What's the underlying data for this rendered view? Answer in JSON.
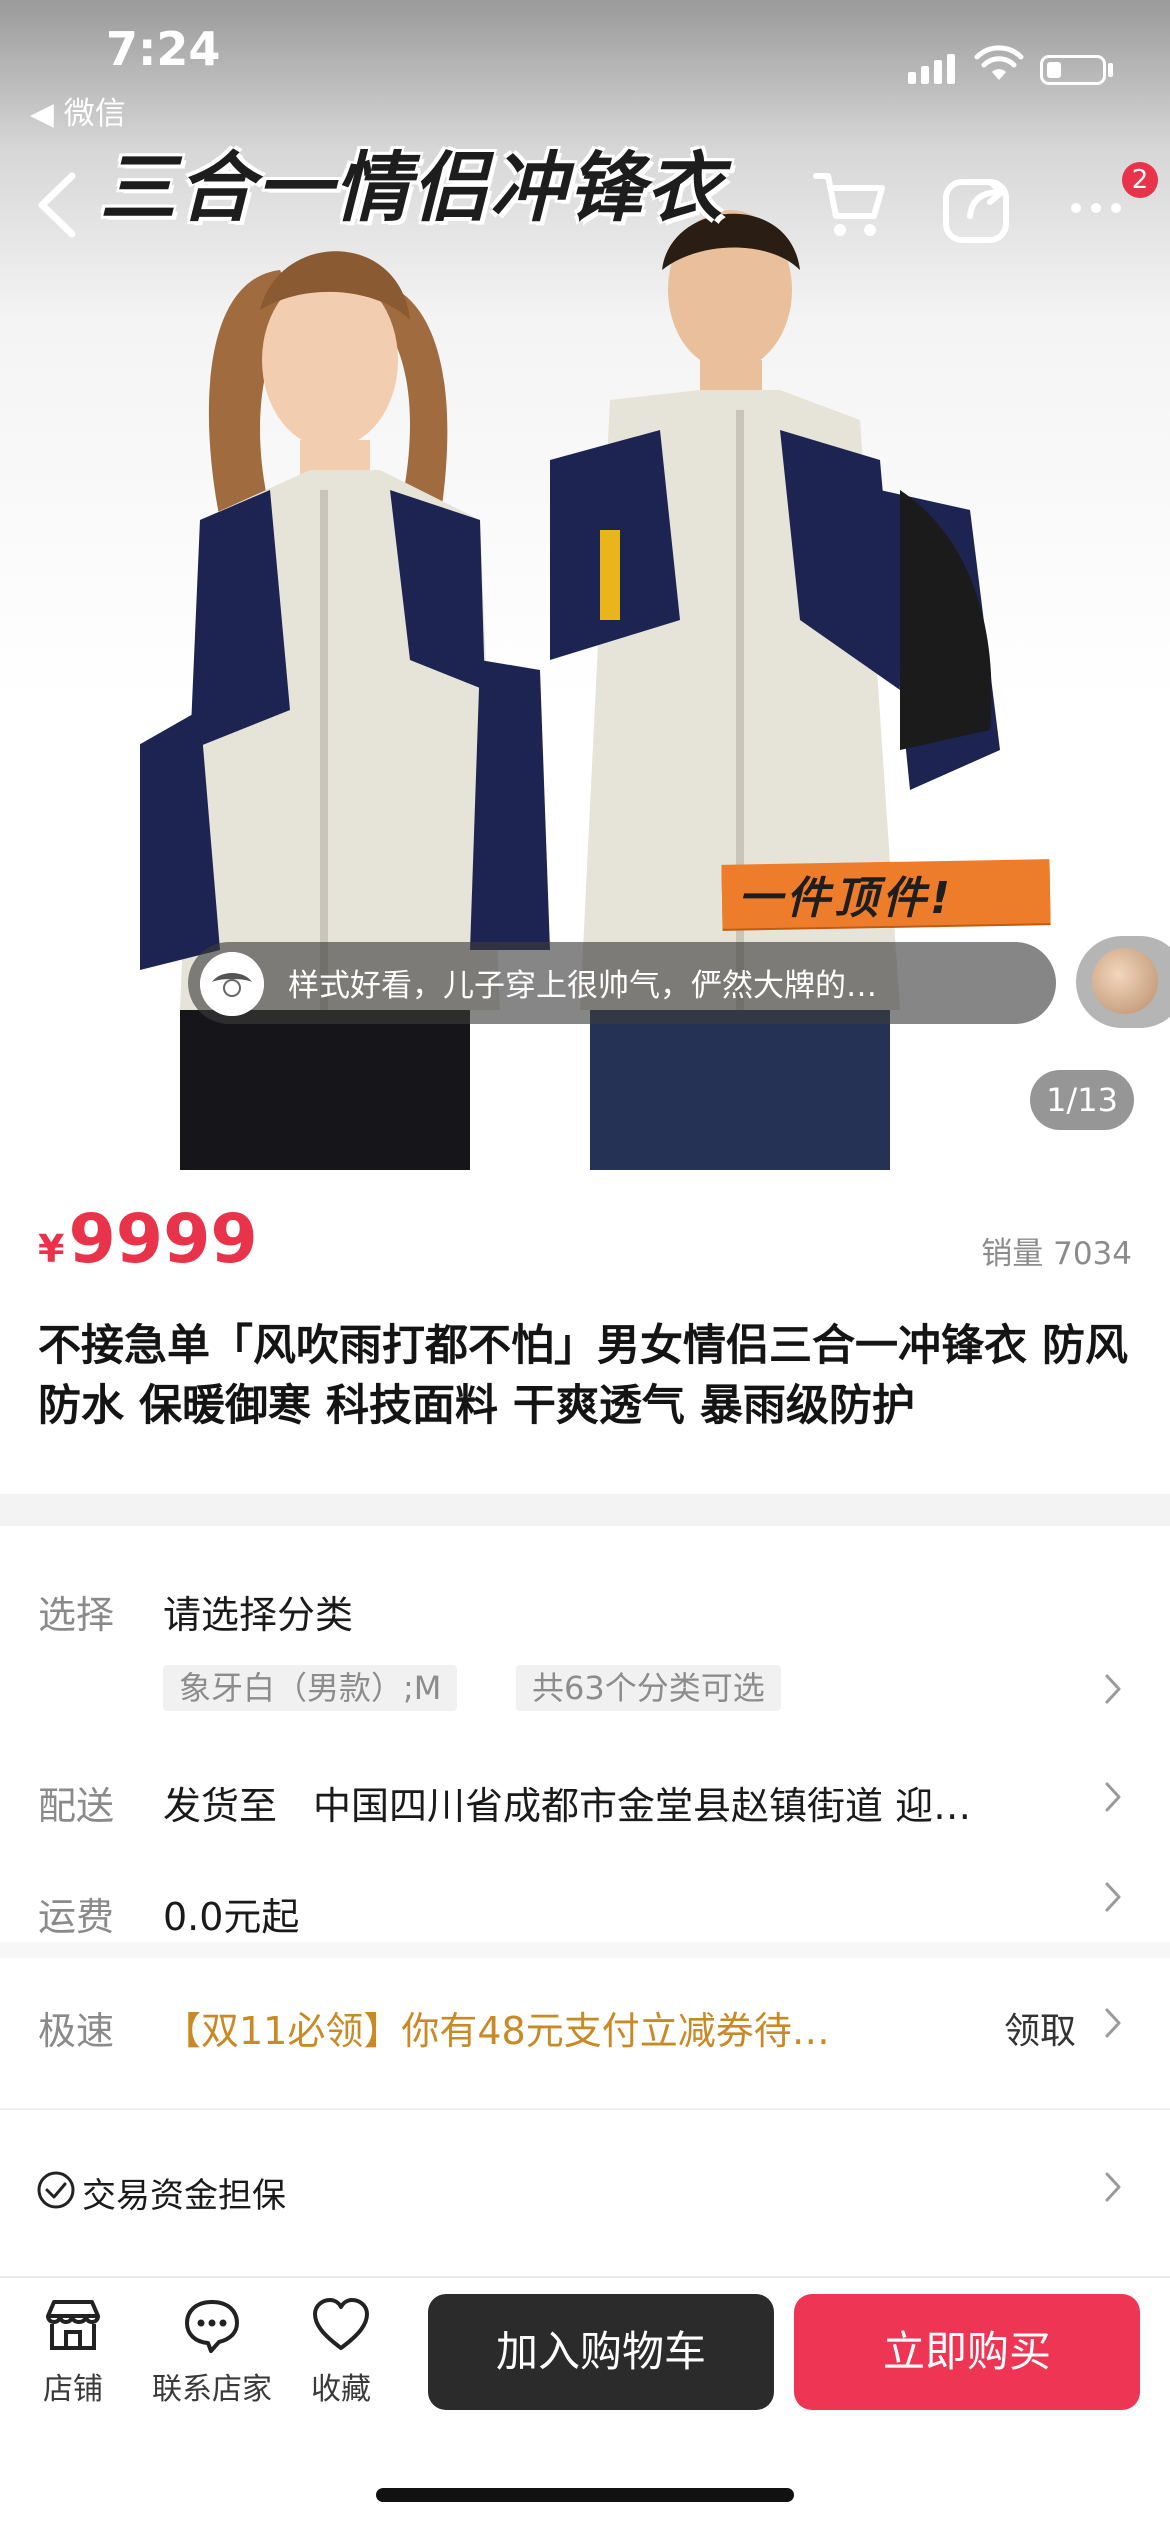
{
  "status_bar": {
    "time": "7:24",
    "back_app_label": "◀ 微信"
  },
  "nav": {
    "headline": "三合一情侣冲锋衣",
    "cart_badge": "2"
  },
  "hero": {
    "stamp_text": "一件顶件!",
    "review_text": "样式好看，儿子穿上很帅气，俨然大牌的…",
    "image_counter": "1/13"
  },
  "product": {
    "currency": "¥",
    "price": "9999",
    "sales": "销量 7034",
    "title": "不接急单「风吹雨打都不怕」男女情侣三合一冲锋衣 防风防水 保暖御寒 科技面料 干爽透气 暴雨级防护"
  },
  "options": {
    "select": {
      "label": "选择",
      "value": "请选择分类",
      "chip_selected": "象牙白（男款）;M",
      "chip_count": "共63个分类可选"
    },
    "delivery": {
      "label": "配送",
      "prefix": "发货至",
      "address": "中国四川省成都市金堂县赵镇街道 迎…"
    },
    "shipping": {
      "label": "运费",
      "value": "0.0元起"
    },
    "express": {
      "label": "极速",
      "promo": "【双11必领】你有48元支付立减券待…",
      "action": "领取"
    },
    "guarantee": {
      "label": "交易资金担保"
    }
  },
  "bottom_bar": {
    "shop_label": "店铺",
    "contact_label": "联系店家",
    "favorite_label": "收藏",
    "add_to_cart": "加入购物车",
    "buy_now": "立即购买"
  },
  "colors": {
    "accent": "#e8334a",
    "buy_button": "#ee3553",
    "cart_button": "#2b2b2b",
    "promo": "#c98a26"
  }
}
